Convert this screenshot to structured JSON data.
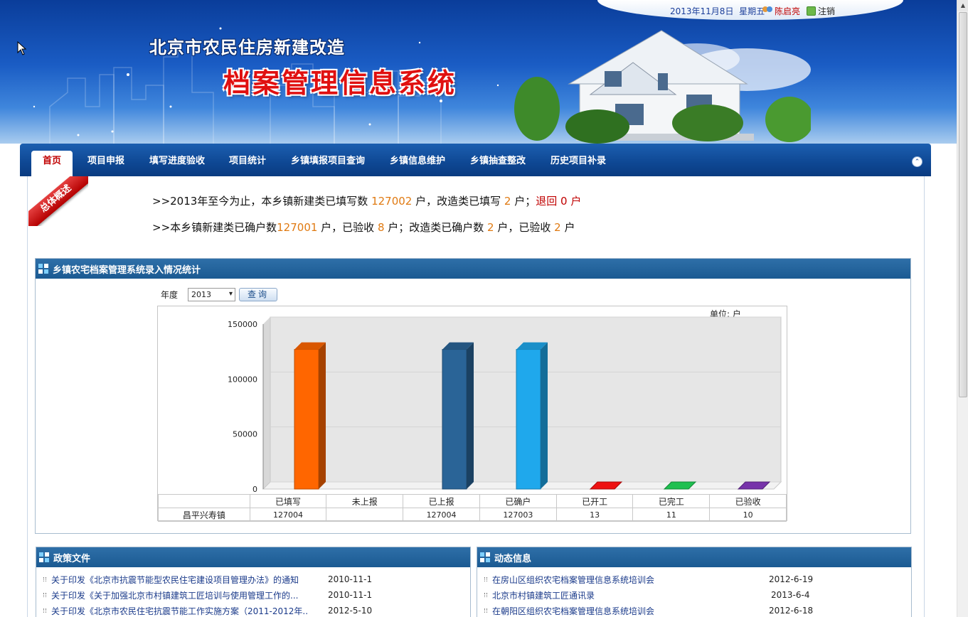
{
  "header": {
    "date": "2013年11月8日",
    "weekday": "星期五",
    "user": "陈启亮",
    "logout": "注销",
    "subtitle": "北京市农民住房新建改造",
    "title": "档案管理信息系统"
  },
  "nav": {
    "items": [
      {
        "label": "首页"
      },
      {
        "label": "项目申报"
      },
      {
        "label": "填写进度验收"
      },
      {
        "label": "项目统计"
      },
      {
        "label": "乡镇填报项目查询"
      },
      {
        "label": "乡镇信息维护"
      },
      {
        "label": "乡镇抽查整改"
      },
      {
        "label": "历史项目补录"
      }
    ]
  },
  "overview": {
    "ribbon": "总体概述",
    "line1": {
      "p1": ">>2013年至今为止，本乡镇新建类已填写数 ",
      "v1": "127002",
      "p2": " 户，改造类已填写 ",
      "v2": " 2 ",
      "p3": " 户；",
      "p4": "退回 ",
      "v3": " 0 ",
      "p5": " 户"
    },
    "line2": {
      "p1": ">>本乡镇新建类已确户数",
      "v1": "127001",
      "p2": " 户，已验收 ",
      "v2": "  8  ",
      "p3": " 户；改造类已确户数 ",
      "v3": "  2  ",
      "p4": " 户，已验收 ",
      "v4": " 2 ",
      "p5": " 户"
    }
  },
  "stats_panel": {
    "title": "乡镇农宅档案管理系统录入情况统计",
    "year_label": "年度",
    "year_value": "2013",
    "query_button": "查询",
    "unit": "单位: 户",
    "row_label": "昌平兴寿镇"
  },
  "chart_data": {
    "type": "bar",
    "categories": [
      "已填写",
      "未上报",
      "已上报",
      "已确户",
      "已开工",
      "已完工",
      "已验收"
    ],
    "values": [
      127004,
      0,
      127004,
      127003,
      13,
      11,
      10
    ],
    "value_labels": [
      "127004",
      "",
      "127004",
      "127003",
      "13",
      "11",
      "10"
    ],
    "colors": [
      "#ff6600",
      "#3366cc",
      "#2a6497",
      "#1fa8ec",
      "#ee1111",
      "#1fc050",
      "#7733aa"
    ],
    "ylim": [
      0,
      150000
    ],
    "yticks": [
      0,
      50000,
      100000,
      150000
    ],
    "ytick_labels": [
      "0",
      "50000",
      "100000",
      "150000"
    ],
    "grid": true
  },
  "policy_panel": {
    "title": "政策文件",
    "items": [
      {
        "text": "关于印发《北京市抗震节能型农民住宅建设项目管理办法》的通知",
        "date": "2010-11-1"
      },
      {
        "text": "关于印发《关于加强北京市村镇建筑工匠培训与使用管理工作的...",
        "date": "2010-11-1"
      },
      {
        "text": "关于印发《北京市农民住宅抗震节能工作实施方案（2011-2012年...",
        "date": "2012-5-10"
      }
    ]
  },
  "news_panel": {
    "title": "动态信息",
    "items": [
      {
        "text": "在房山区组织农宅档案管理信息系统培训会",
        "date": "2012-6-19"
      },
      {
        "text": "北京市村镇建筑工匠通讯录",
        "date": "2013-6-4"
      },
      {
        "text": "在朝阳区组织农宅档案管理信息系统培训会",
        "date": "2012-6-18"
      }
    ]
  }
}
